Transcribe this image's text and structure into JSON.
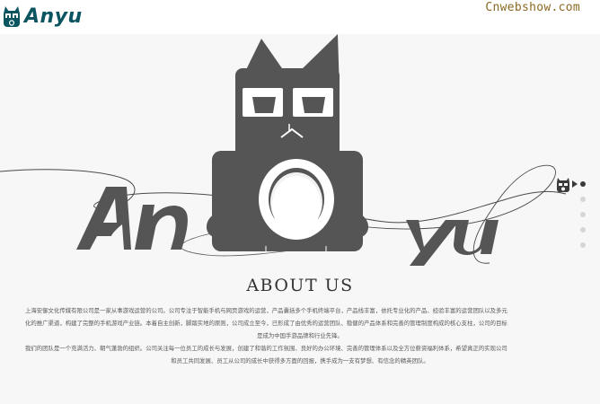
{
  "header": {
    "logo_text": "Anyu",
    "logo_icon": "mascot-cat-icon",
    "watermark": "Cnwebshow.com"
  },
  "hero": {
    "letters": [
      "An",
      "yu"
    ],
    "mascot_icon": "cat-mascot-illustration"
  },
  "side_nav": {
    "icon": "mascot-cat-icon",
    "active_index": 0,
    "dots": 5
  },
  "about": {
    "title": "ABOUT US",
    "paragraph1_line1": "上海安御文化传媒有限公司是一家从事游戏运营的公司。公司专注于智能手机与网页游戏的运营，产品囊括多个手机终端平台，产品线丰富，依托专业化的产品、经验丰富的运营团队以及多元",
    "paragraph1_line2": "化的推广渠道，构建了完整的手机游戏产业链。本着自主创新，脚踏实地的原则，公司成立至今，已形成了由优秀的运营团队、稳健的产品体系和完善的管理制度构成的核心支柱，公司的目标",
    "paragraph1_line3": "是成为中国手游品牌和行业先锋。",
    "paragraph2_line1": "我们的团队是一个充满活力、朝气蓬勃的组织。公司关注每一位员工的成长与发展，创建了和谐的工作氛围、良好的办公环境、完善的管理体系以及全方位薪资福利体系，希望真正的实现公司",
    "paragraph2_line2": "和员工共同发展、员工从公司的成长中获得多方面的回报，携手成为一支有梦想、有信念的精英团队。"
  },
  "colors": {
    "logo": "#0a5560",
    "mascot": "#555555",
    "watermark": "#8a6a22",
    "background": "#f7f7f7"
  }
}
